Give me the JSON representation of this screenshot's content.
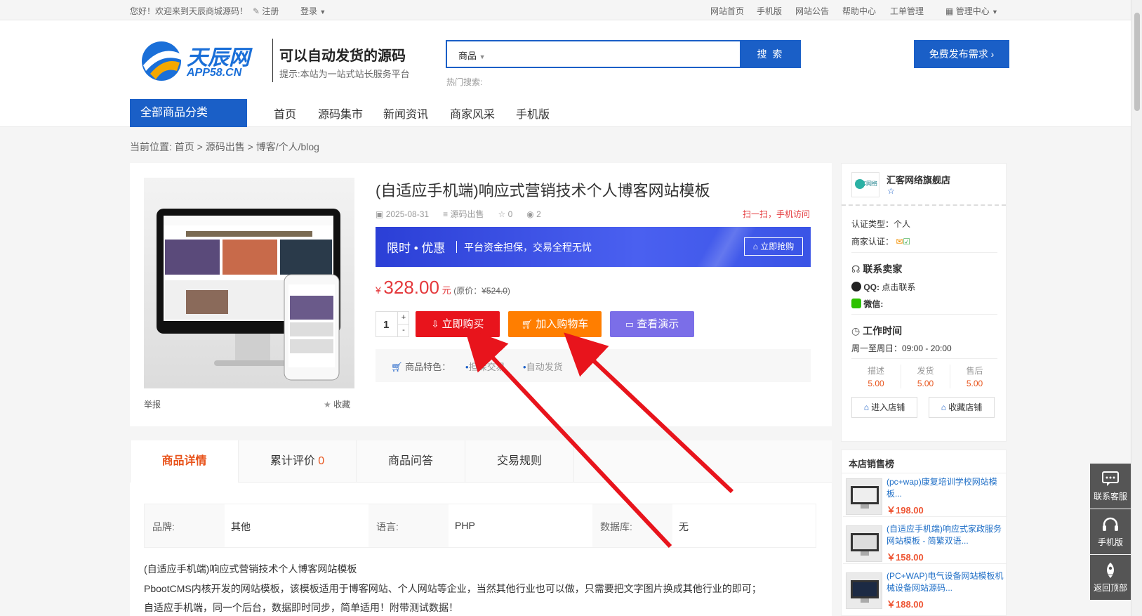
{
  "topbar": {
    "welcome": "您好！欢迎来到天辰商城源码！",
    "register": "注册",
    "login": "登录",
    "links": [
      "网站首页",
      "手机版",
      "网站公告",
      "帮助中心",
      "工单管理"
    ],
    "admin": "管理中心"
  },
  "header": {
    "logo_cn": "天辰网",
    "logo_en": "APP58.CN",
    "slogan": "可以自动发货的源码",
    "slogan_sub": "提示:本站为一站式站长服务平台",
    "search_category": "商品",
    "search_placeholder": "",
    "search_button": "搜 索",
    "hot_search": "热门搜索:",
    "publish_button": "免费发布需求"
  },
  "nav": {
    "all_categories": "全部商品分类",
    "items": [
      "首页",
      "源码集市",
      "新闻资讯",
      "商家风采",
      "手机版"
    ]
  },
  "breadcrumb": {
    "label": "当前位置:",
    "items": [
      "首页",
      "源码出售",
      "博客/个人/blog"
    ],
    "sep": ">"
  },
  "product": {
    "title": "(自适应手机端)响应式营销技术个人博客网站模板",
    "date": "2025-08-31",
    "category": "源码出售",
    "favorites": "0",
    "views": "2",
    "mobile_visit": "扫一扫，手机访问",
    "promo_tag": "限时 • 优惠",
    "promo_text": "平台资金担保，交易全程无忧",
    "promo_button": "立即抢购",
    "currency": "¥",
    "price": "328.00",
    "price_unit": "元",
    "original_label": "(原价：",
    "original_price": "¥524.0",
    "original_close": ")",
    "quantity": "1",
    "buy_now": "立即购买",
    "add_cart": "加入购物车",
    "demo": "查看演示",
    "features_label": "商品特色：",
    "features": [
      "担保交易",
      "自动发货"
    ],
    "report": "举报",
    "collect": "收藏"
  },
  "tabs": {
    "detail": "商品详情",
    "reviews": "累计评价",
    "reviews_count": "0",
    "qa": "商品问答",
    "rules": "交易规则"
  },
  "attrs": [
    {
      "label": "品牌:",
      "value": "其他"
    },
    {
      "label": "语言:",
      "value": "PHP"
    },
    {
      "label": "数据库:",
      "value": "无"
    }
  ],
  "description": [
    "(自适应手机端)响应式营销技术个人博客网站模板",
    "PbootCMS内核开发的网站模板，该模板适用于博客网站、个人网站等企业，当然其他行业也可以做，只需要把文字图片换成其他行业的即可；",
    "自适应手机端，同一个后台，数据即时同步，简单适用！附带测试数据！"
  ],
  "shop": {
    "name": "汇客网络旗舰店",
    "logo_text": "汇客网络",
    "cert_type_label": "认证类型：",
    "cert_type": "个人",
    "merchant_cert_label": "商家认证：",
    "contact_title": "联系卖家",
    "qq_label": "QQ:",
    "qq_value": "点击联系",
    "wechat_label": "微信:",
    "hours_title": "工作时间",
    "hours": "周一至周日：09:00 - 20:00",
    "scores": [
      {
        "label": "描述",
        "value": "5.00"
      },
      {
        "label": "发货",
        "value": "5.00"
      },
      {
        "label": "售后",
        "value": "5.00"
      }
    ],
    "enter_shop": "进入店铺",
    "collect_shop": "收藏店铺"
  },
  "ranking": {
    "title": "本店销售榜",
    "items": [
      {
        "name": "(pc+wap)康复培训学校网站模板...",
        "price": "￥198.00"
      },
      {
        "name": "(自适应手机端)响应式家政服务网站模板 - 简繁双语...",
        "price": "￥158.00"
      },
      {
        "name": "(PC+WAP)电气设备网站模板机械设备网站源码...",
        "price": "￥188.00"
      }
    ]
  },
  "float": {
    "service": "联系客服",
    "mobile": "手机版",
    "top": "返回顶部"
  },
  "colors": {
    "brand_blue": "#1a5fc7",
    "buy_red": "#e8141c",
    "cart_orange": "#ff7e00",
    "demo_purple": "#7b6ee8",
    "price_red": "#e4393c"
  }
}
